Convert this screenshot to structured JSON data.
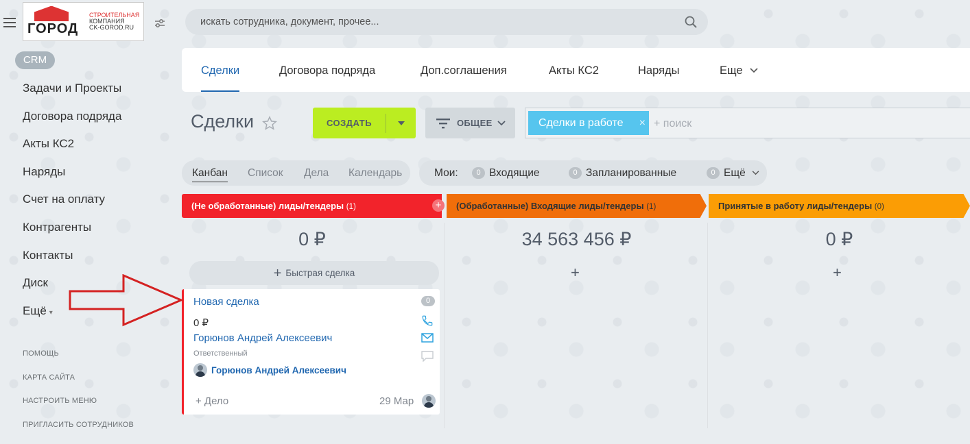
{
  "logo": {
    "word": "ГОРОД",
    "line1": "СТРОИТЕЛЬНАЯ",
    "line2": "КОМПАНИЯ",
    "line3": "CK-GOROD.RU"
  },
  "search": {
    "placeholder": "искать сотрудника, документ, прочее..."
  },
  "sidebar": {
    "crm_label": "CRM",
    "items": [
      {
        "label": "Задачи и Проекты"
      },
      {
        "label": "Договора подряда"
      },
      {
        "label": "Акты КС2"
      },
      {
        "label": "Наряды"
      },
      {
        "label": "Счет на оплату"
      },
      {
        "label": "Контрагенты"
      },
      {
        "label": "Контакты"
      },
      {
        "label": "Диск"
      },
      {
        "label": "Ещё"
      }
    ],
    "system_links": [
      {
        "label": "ПОМОЩЬ"
      },
      {
        "label": "КАРТА САЙТА"
      },
      {
        "label": "НАСТРОИТЬ МЕНЮ"
      },
      {
        "label": "ПРИГЛАСИТЬ СОТРУДНИКОВ"
      }
    ]
  },
  "tabs": [
    {
      "label": "Сделки",
      "active": true
    },
    {
      "label": "Договора подряда"
    },
    {
      "label": "Доп.соглашения"
    },
    {
      "label": "Акты КС2"
    },
    {
      "label": "Наряды"
    },
    {
      "label": "Еще"
    }
  ],
  "page_title": "Сделки",
  "toolbar": {
    "create_label": "СОЗДАТЬ",
    "filter_label": "ОБЩЕЕ",
    "filter_chip": "Сделки в работе",
    "chip_close": "×",
    "search_placeholder": "+ поиск"
  },
  "views": [
    "Канбан",
    "Список",
    "Дела",
    "Календарь"
  ],
  "counters": {
    "mine_label": "Мои:",
    "items": [
      {
        "count": "0",
        "label": "Входящие"
      },
      {
        "count": "0",
        "label": "Запланированные"
      },
      {
        "count": "0",
        "label": "Ещё"
      }
    ]
  },
  "columns": [
    {
      "title": "(Не обработанные) лиды/тендеры",
      "count": "(1)",
      "sum": "0 ₽",
      "color": "#f2232b"
    },
    {
      "title": "(Обработанные) Входящие лиды/тендеры",
      "count": "(1)",
      "sum": "34 563 456 ₽",
      "color": "#f06e0a"
    },
    {
      "title": "Принятые в работу лиды/тендеры",
      "count": "(0)",
      "sum": "0 ₽",
      "color": "#fb9d05"
    }
  ],
  "quick_deal_label": "Быстрая сделка",
  "card": {
    "title": "Новая сделка",
    "badge": "0",
    "sum": "0 ₽",
    "contact": "Горюнов Андрей Алексеевич",
    "role": "Ответственный",
    "responsible": "Горюнов Андрей Алексеевич",
    "add_activity": "+ Дело",
    "date": "29 Мар"
  }
}
